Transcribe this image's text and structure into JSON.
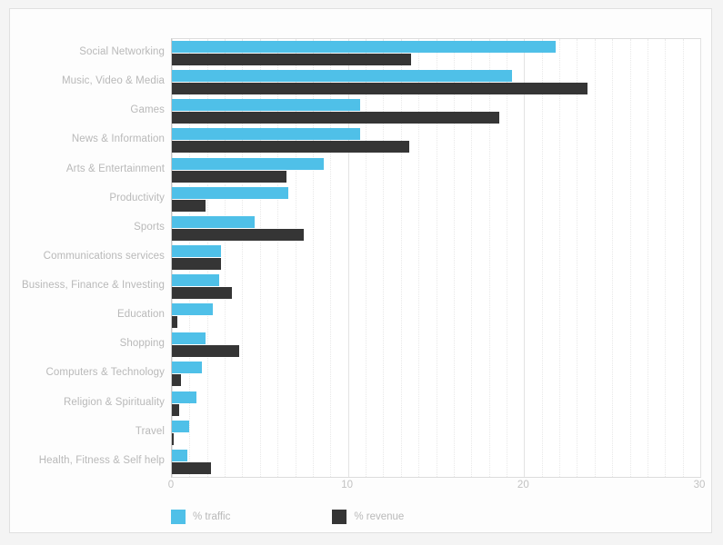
{
  "chart_data": {
    "type": "bar",
    "orientation": "horizontal",
    "title": "",
    "subtitle": "",
    "xlabel": "",
    "ylabel": "",
    "xlim": [
      0,
      30
    ],
    "xticks": [
      0,
      10,
      20,
      30
    ],
    "xtick_labels": [
      "0",
      "10",
      "20",
      "30"
    ],
    "grid": true,
    "grid_axis": "x",
    "grid_style": "dotted",
    "grid_step": 1,
    "legend_position": "bottom-left",
    "categories": [
      "Social Networking",
      "Music, Video & Media",
      "Games",
      "News & Information",
      "Arts & Entertainment",
      "Productivity",
      "Sports",
      "Communications services",
      "Business, Finance & Investing",
      "Education",
      "Shopping",
      "Computers & Technology",
      "Religion & Spirituality",
      "Travel",
      "Health, Fitness & Self help"
    ],
    "series": [
      {
        "name": "% traffic",
        "color": "#4fc0e8",
        "values": [
          21.8,
          19.3,
          10.7,
          10.7,
          8.6,
          6.6,
          4.7,
          2.8,
          2.7,
          2.3,
          1.9,
          1.7,
          1.4,
          1.0,
          0.9
        ]
      },
      {
        "name": "% revenue",
        "color": "#353535",
        "values": [
          13.6,
          23.6,
          18.6,
          13.5,
          6.5,
          1.9,
          7.5,
          2.8,
          3.4,
          0.3,
          3.8,
          0.5,
          0.4,
          0.1,
          2.2
        ]
      }
    ]
  },
  "legend": {
    "items": [
      {
        "label": "% traffic",
        "color": "#4fc0e8"
      },
      {
        "label": "% revenue",
        "color": "#353535"
      }
    ]
  },
  "colors": {
    "traffic": "#4fc0e8",
    "revenue": "#353535",
    "label_text": "#b9b9b9",
    "grid": "#e8e8e8",
    "plot_border": "#dcdcdc",
    "card_background": "#fdfdfd",
    "page_background": "#f4f4f4"
  }
}
